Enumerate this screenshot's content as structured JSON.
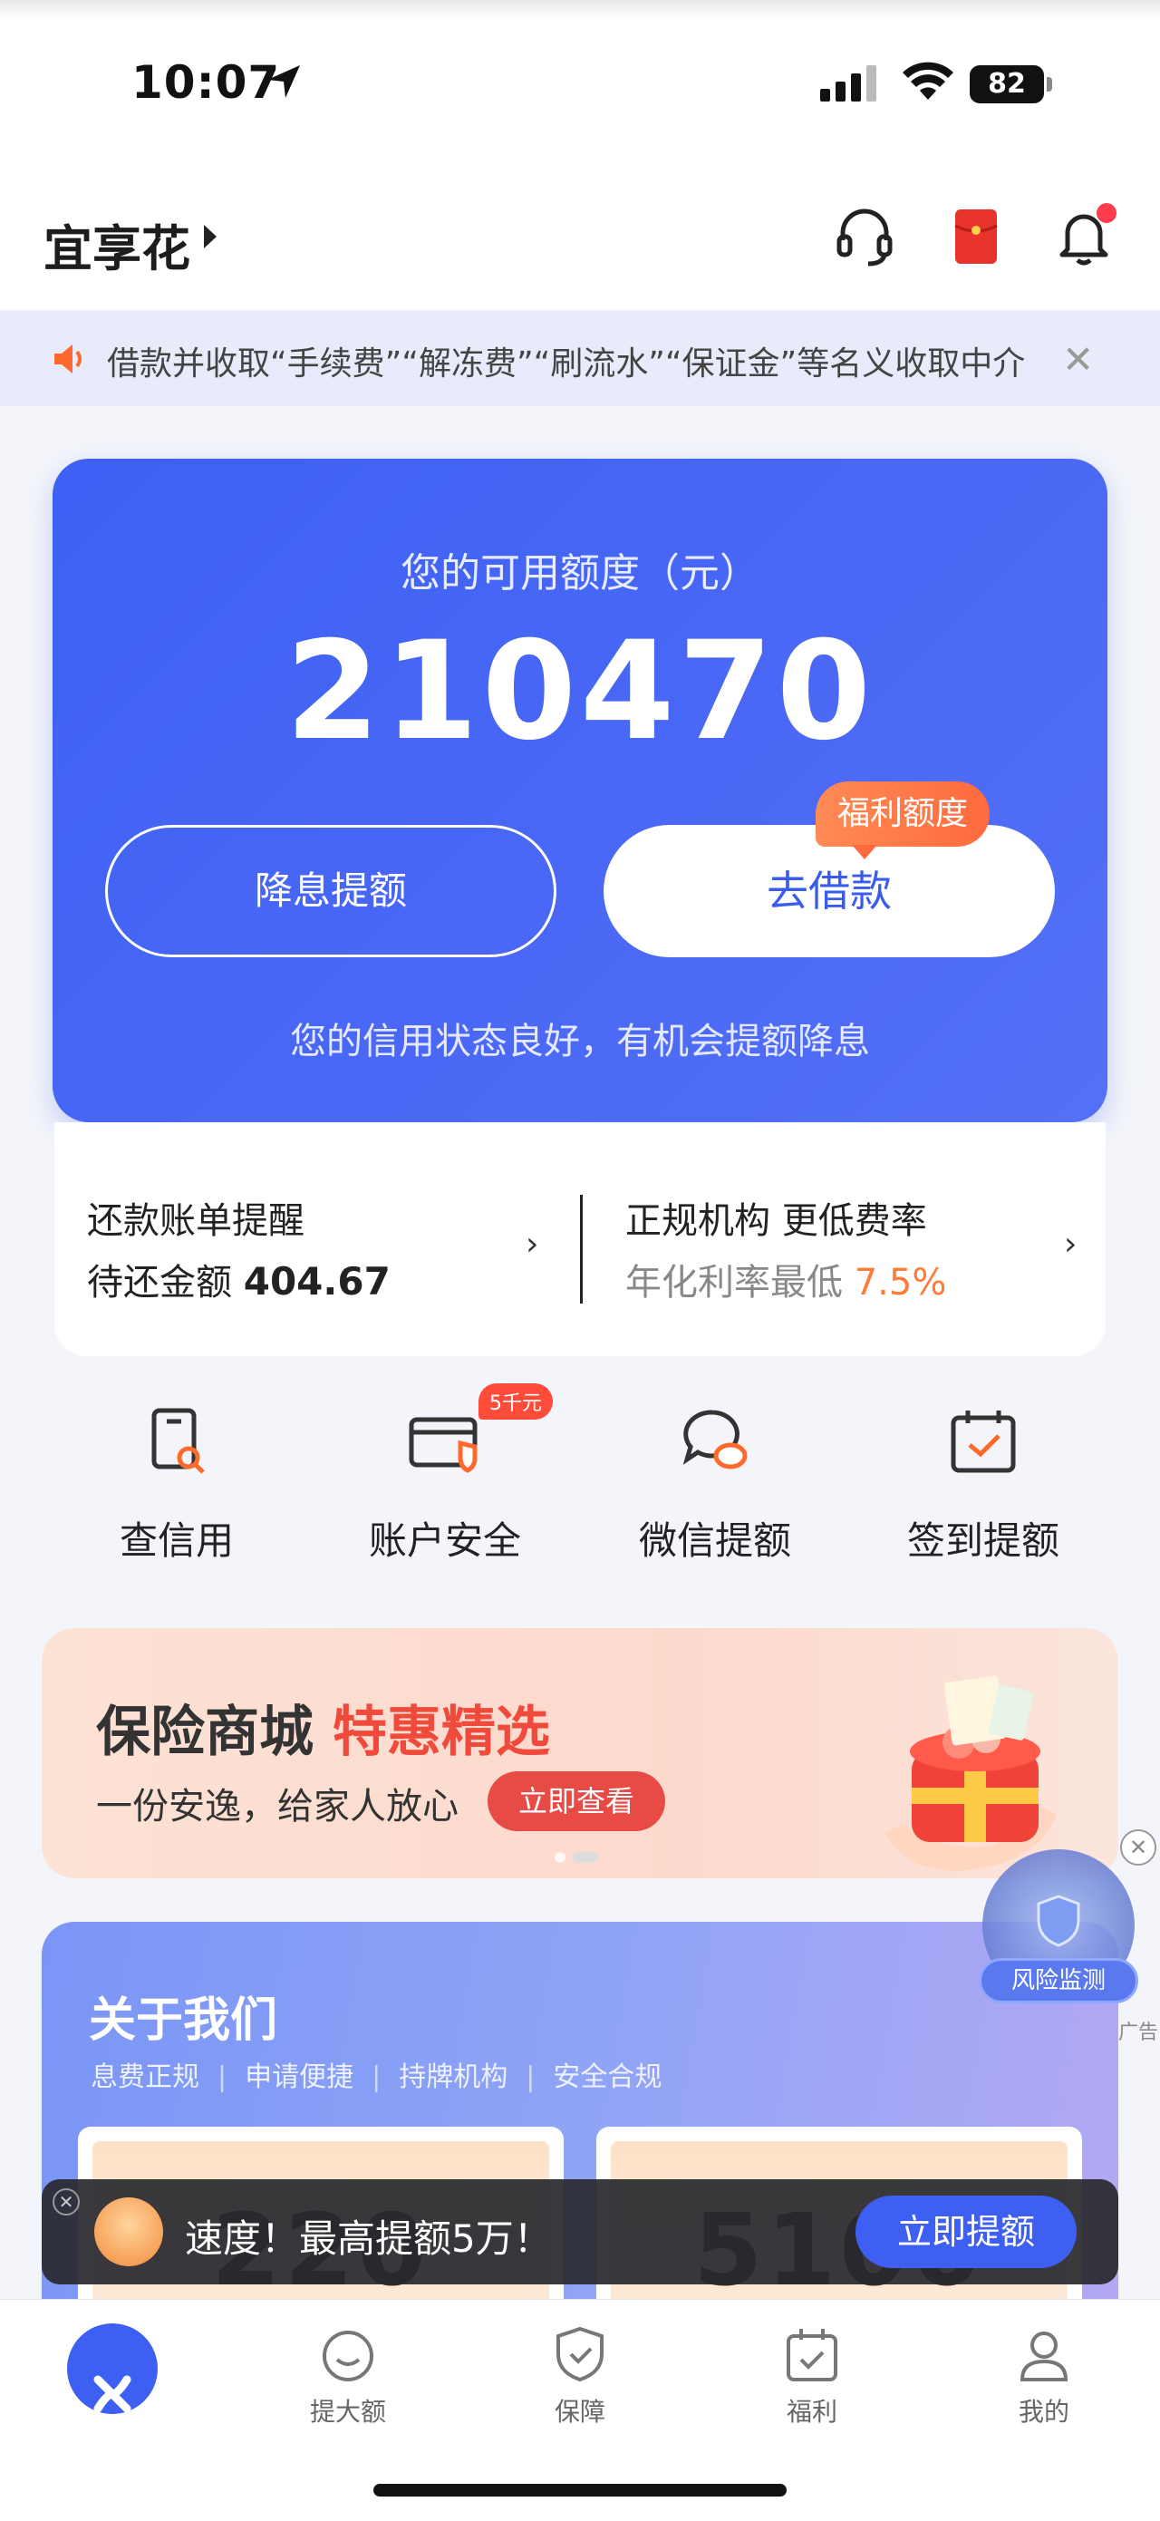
{
  "status_bar": {
    "time": "10:07",
    "battery": "82"
  },
  "header": {
    "brand": "宜享花"
  },
  "notice": {
    "text": "借款并收取“手续费”“解冻费”“刷流水”“保证金”等名义收取中介"
  },
  "credit": {
    "label": "您的可用额度（元）",
    "amount": "210470",
    "left_button": "降息提额",
    "right_button": "去借款",
    "tag": "福利额度",
    "subtitle": "您的信用状态良好，有机会提额降息"
  },
  "bill": {
    "left_title": "还款账单提醒",
    "left_sub_label": "待还金额",
    "left_sub_value": "404.67",
    "right_title": "正规机构 更低费率",
    "right_sub_label": "年化利率最低",
    "right_sub_value": "7.5%"
  },
  "quick_menu": [
    {
      "label": "查信用",
      "icon": "credit-check-icon"
    },
    {
      "label": "账户安全",
      "icon": "account-security-icon",
      "badge": "5千元"
    },
    {
      "label": "微信提额",
      "icon": "wechat-chat-icon"
    },
    {
      "label": "签到提额",
      "icon": "calendar-check-icon"
    }
  ],
  "insurance": {
    "title_main": "保险商城",
    "title_accent": "特惠精选",
    "subtitle": "一份安逸，给家人放心",
    "button": "立即查看"
  },
  "about": {
    "title": "关于我们",
    "tags": [
      "息费正规",
      "申请便捷",
      "持牌机构",
      "安全合规"
    ],
    "stats": [
      "220",
      "5100"
    ]
  },
  "risk": {
    "label": "风险监测",
    "ad": "广告"
  },
  "toast": {
    "text": "速度！最高提额5万！",
    "button": "立即提额"
  },
  "tabbar": [
    {
      "label": "",
      "icon": "home-logo-icon"
    },
    {
      "label": "提大额",
      "icon": "smile-icon"
    },
    {
      "label": "保障",
      "icon": "shield-icon"
    },
    {
      "label": "福利",
      "icon": "calendar-icon"
    },
    {
      "label": "我的",
      "icon": "user-icon"
    }
  ],
  "colors": {
    "primary": "#3d5ff2",
    "accent": "#ff7b3a",
    "danger": "#e84a46"
  }
}
